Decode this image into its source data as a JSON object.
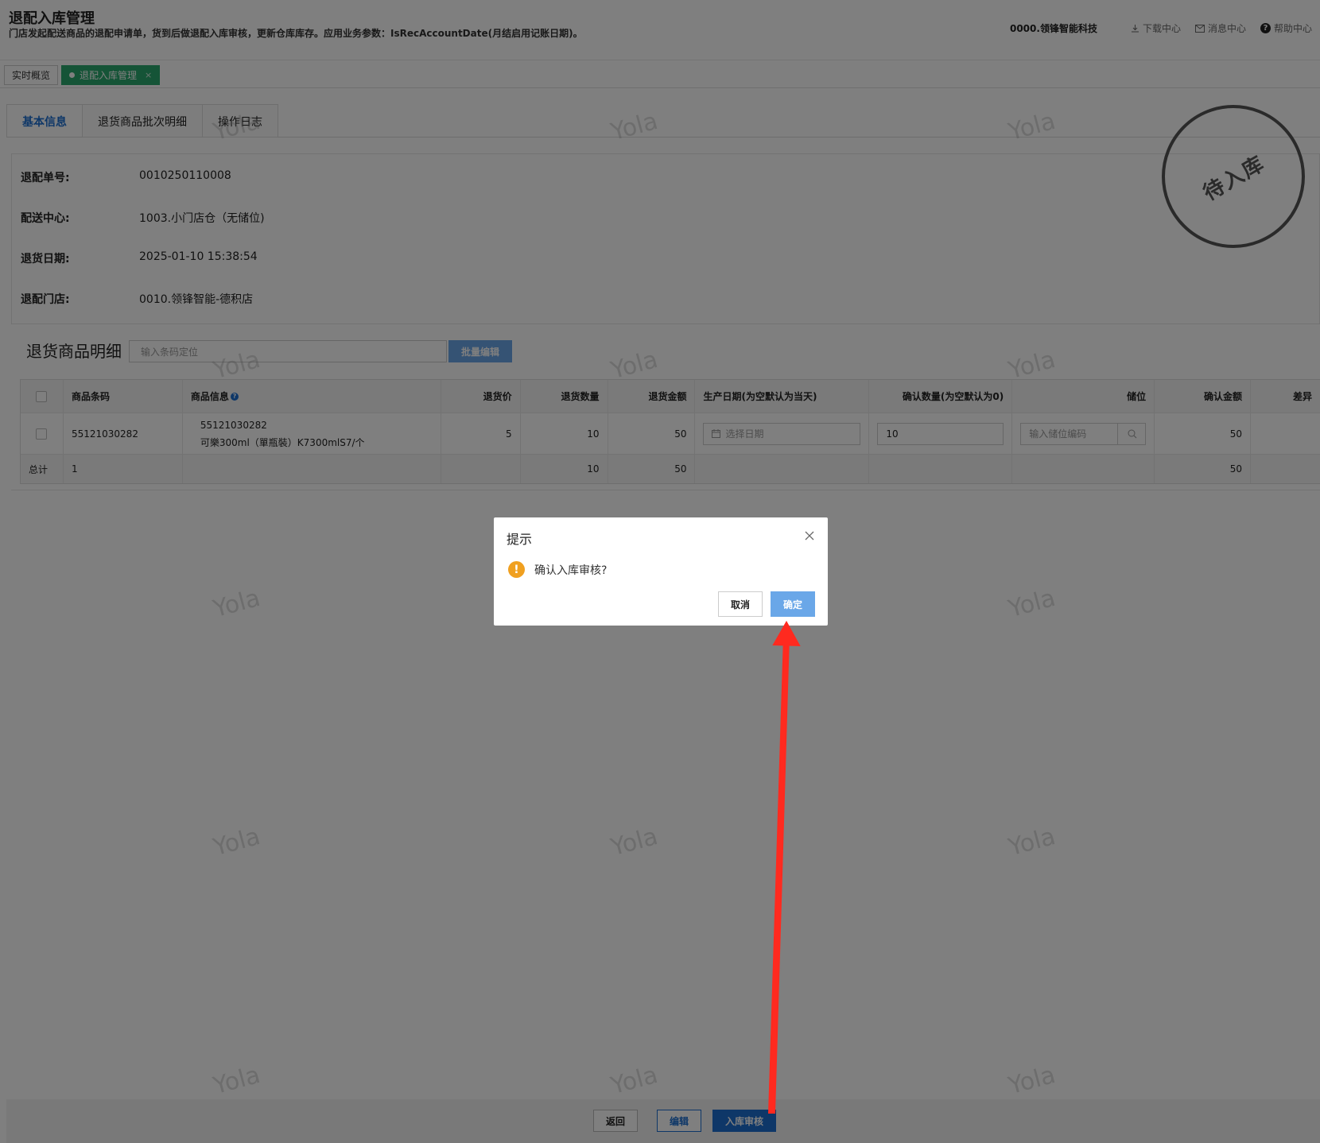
{
  "header": {
    "title": "退配入库管理",
    "description": "门店发起配送商品的退配申请单，货到后做退配入库审核，更新仓库库存。应用业务参数：IsRecAccountDate(月结启用记账日期)。",
    "org": "0000.领锋智能科技",
    "download": "下载中心",
    "message": "消息中心",
    "help": "帮助中心"
  },
  "page_tabs": {
    "overview": "实时概览",
    "current": "退配入库管理",
    "close": "×"
  },
  "content_tabs": [
    "基本信息",
    "退货商品批次明细",
    "操作日志"
  ],
  "info": {
    "order_no_label": "退配单号:",
    "order_no": "0010250110008",
    "center_label": "配送中心:",
    "center": "1003.小门店仓（无储位)",
    "date_label": "退货日期:",
    "date": "2025-01-10 15:38:54",
    "store_label": "退配门店:",
    "store": "0010.领锋智能-德积店"
  },
  "stamp": "待入库",
  "detail": {
    "title": "退货商品明细",
    "search_placeholder": "输入条码定位",
    "batch_edit": "批量编辑"
  },
  "table": {
    "headers": [
      "商品条码",
      "商品信息",
      "退货价",
      "退货数量",
      "退货金额",
      "生产日期(为空默认为当天)",
      "确认数量(为空默认为0)",
      "储位",
      "确认金额",
      "差异"
    ],
    "row": {
      "barcode": "55121030282",
      "info_code": "55121030282",
      "info_name": "可樂300ml（單瓶裝）K7300mlS7/个",
      "price": "5",
      "qty": "10",
      "amount": "50",
      "date_placeholder": "选择日期",
      "confirm_qty": "10",
      "location_placeholder": "输入储位编码",
      "confirm_amount": "50"
    },
    "footer": {
      "label": "总计",
      "count": "1",
      "qty": "10",
      "amount": "50",
      "confirm_amount": "50"
    }
  },
  "buttons": {
    "back": "返回",
    "edit": "编辑",
    "audit": "入库审核"
  },
  "watermark": "Yola",
  "modal": {
    "title": "提示",
    "message": "确认入库审核?",
    "cancel": "取消",
    "ok": "确定"
  },
  "colors": {
    "accent": "#1c6fd1",
    "tab_active": "#2ba96e",
    "warning": "#f0a020",
    "arrow": "#ff2a1f"
  }
}
